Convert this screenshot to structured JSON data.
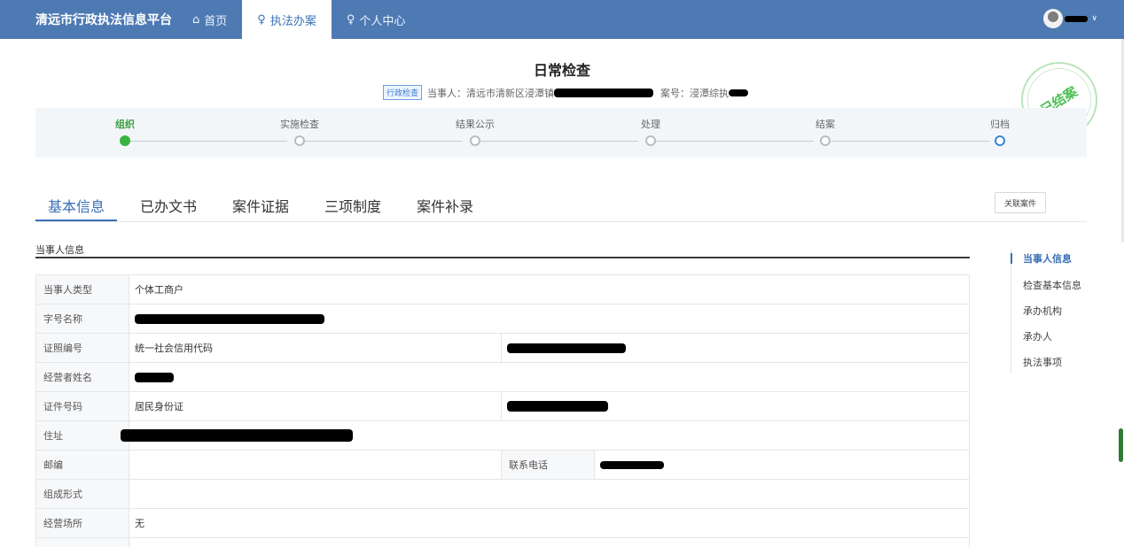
{
  "app": {
    "brand": "清远市行政执法信息平台",
    "nav": [
      {
        "label": "首页",
        "icon": "home-icon"
      },
      {
        "label": "执法办案",
        "icon": "user-icon"
      },
      {
        "label": "个人中心",
        "icon": "user-icon"
      }
    ]
  },
  "case": {
    "title": "日常检查",
    "tag": "行政检查",
    "party_prefix": "当事人：清远市清新区浸潭镇",
    "case_no_prefix": "案号：浸潭综执",
    "stamp": "已结案"
  },
  "steps": [
    {
      "label": "组织",
      "status": "done"
    },
    {
      "label": "实施检查",
      "status": "todo"
    },
    {
      "label": "结果公示",
      "status": "todo"
    },
    {
      "label": "处理",
      "status": "todo"
    },
    {
      "label": "结案",
      "status": "todo"
    },
    {
      "label": "归档",
      "status": "current"
    }
  ],
  "tabs": [
    "基本信息",
    "已办文书",
    "案件证据",
    "三项制度",
    "案件补录"
  ],
  "link_button": "关联案件",
  "section_title": "当事人信息",
  "fields": {
    "party_type_label": "当事人类型",
    "party_type_value": "个体工商户",
    "name_label": "字号名称",
    "license_label": "证照编号",
    "license_type": "统一社会信用代码",
    "operator_label": "经营者姓名",
    "id_label": "证件号码",
    "id_type": "居民身份证",
    "address_label": "住址",
    "postcode_label": "邮编",
    "phone_label": "联系电话",
    "form_label": "组成形式",
    "premises_label": "经营场所",
    "premises_value": "无"
  },
  "anchors": [
    "当事人信息",
    "检查基本信息",
    "承办机构",
    "承办人",
    "执法事项"
  ],
  "colors": {
    "nav_bg": "#4e7ab4",
    "accent": "#3b6fb6",
    "done": "#38b53f",
    "stamp": "#4cc055"
  }
}
